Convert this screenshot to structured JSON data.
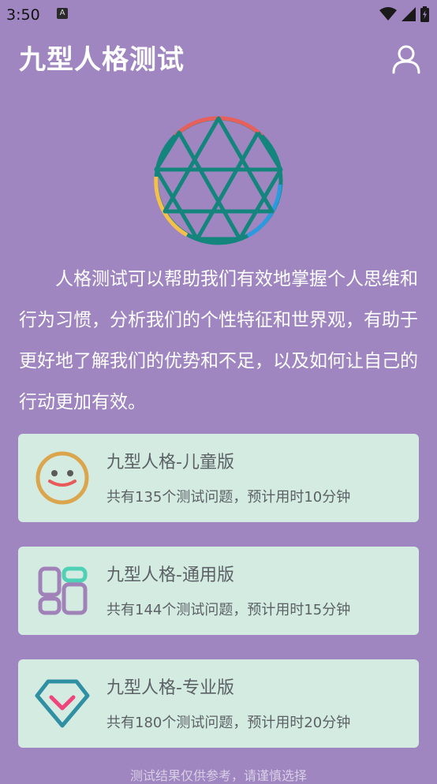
{
  "status_bar": {
    "time": "3:50",
    "notification_glyph": "A"
  },
  "app_bar": {
    "title": "九型人格测试",
    "profile_icon": "person-outline-icon"
  },
  "logo_icon": "enneagram-icon",
  "description": "人格测试可以帮助我们有效地掌握个人思维和行为习惯，分析我们的个性特征和世界观，有助于更好地了解我们的优势和不足，以及如何让自己的行动更加有效。",
  "cards": [
    {
      "icon": "smiley-face-icon",
      "title": "九型人格-儿童版",
      "subtitle": "共有135个测试问题，预计用时10分钟"
    },
    {
      "icon": "grid-blocks-icon",
      "title": "九型人格-通用版",
      "subtitle": "共有144个测试问题，预计用时15分钟"
    },
    {
      "icon": "diamond-check-icon",
      "title": "九型人格-专业版",
      "subtitle": "共有180个测试问题，预计用时20分钟"
    }
  ],
  "footer_note": "测试结果仅供参考，请谨慎选择",
  "colors": {
    "background": "#9f86c0",
    "card_background": "#d4ebe1",
    "card_text": "#5c6165",
    "logo_teal": "#14857c"
  }
}
